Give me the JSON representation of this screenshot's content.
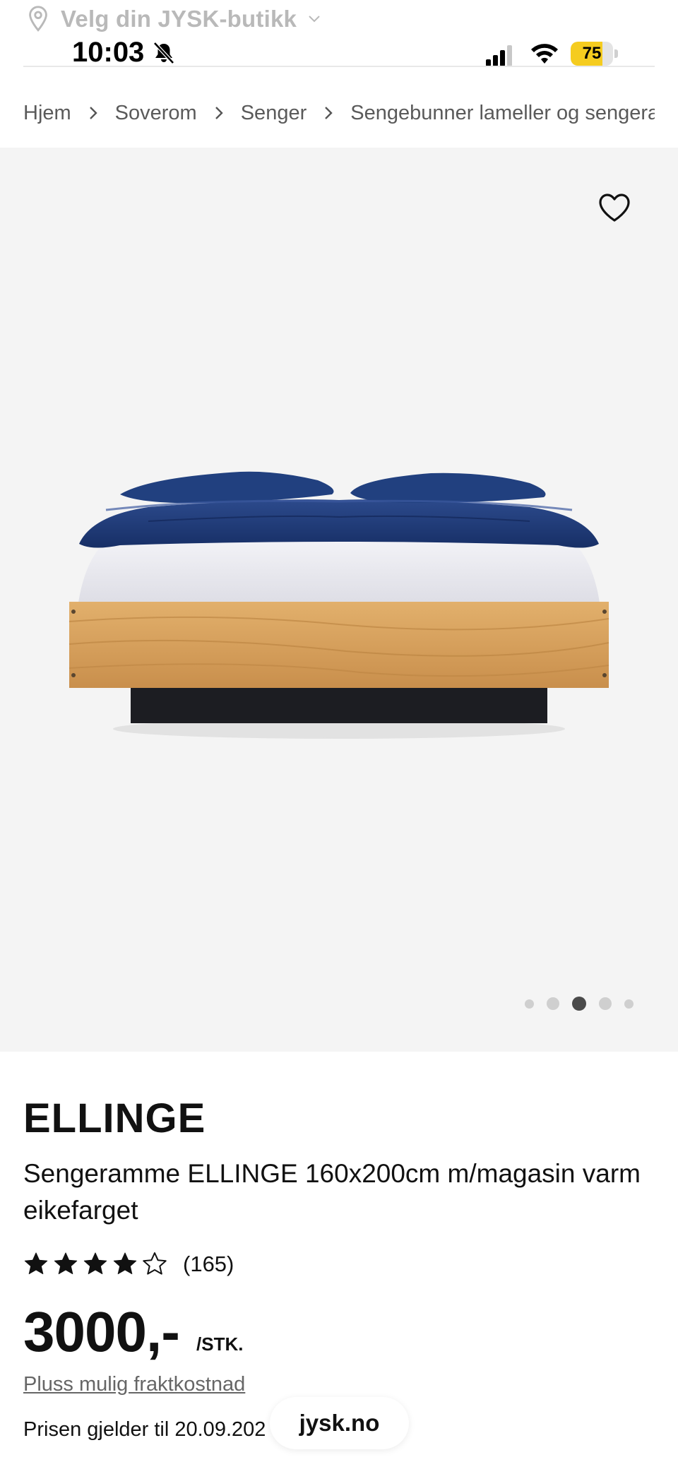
{
  "store_selector": {
    "label": "Velg din JYSK-butikk",
    "icon": "location-pin-icon"
  },
  "status_bar": {
    "time": "10:03",
    "battery": "75",
    "battery_level": 0.75
  },
  "breadcrumb": [
    "Hjem",
    "Soverom",
    "Senger",
    "Sengebunner lameller og sengera"
  ],
  "gallery": {
    "image_count": 5,
    "active_index": 2
  },
  "product": {
    "brand": "ELLINGE",
    "description": "Sengeramme ELLINGE 160x200cm m/magasin varm eikefarget",
    "rating": 4,
    "rating_max": 5,
    "review_count": "(165)",
    "price": "3000,-",
    "unit": "/STK.",
    "shipping_link": "Pluss mulig fraktkostnad",
    "price_valid": "Prisen gjelder til 20.09.202"
  },
  "domain_pill": "jysk.no",
  "colors": {
    "gallery_bg": "#f4f4f4",
    "battery": "#f5cc1f",
    "duvet": "#1f3a78",
    "oak": "#d9a45e"
  }
}
